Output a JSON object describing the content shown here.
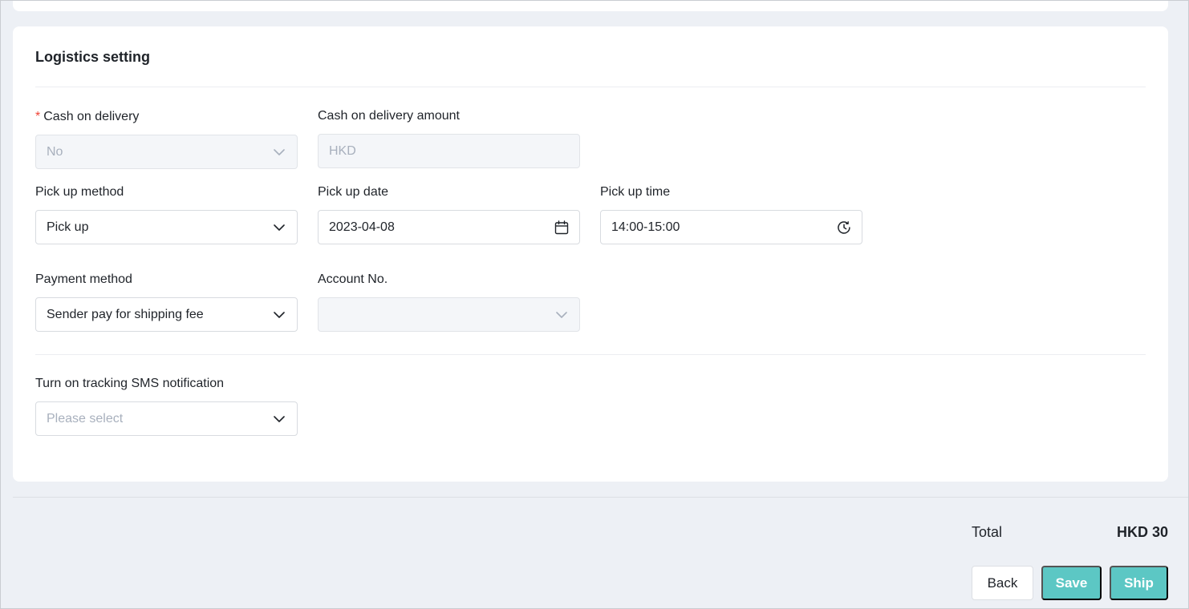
{
  "section": {
    "title": "Logistics setting"
  },
  "fields": {
    "cod": {
      "label": "Cash on delivery",
      "required_mark": "*",
      "value": "No"
    },
    "cod_amount": {
      "label": "Cash on delivery amount",
      "placeholder": "HKD"
    },
    "pickup_method": {
      "label": "Pick up method",
      "value": "Pick up"
    },
    "pickup_date": {
      "label": "Pick up date",
      "value": "2023-04-08"
    },
    "pickup_time": {
      "label": "Pick up time",
      "value": "14:00-15:00"
    },
    "payment_method": {
      "label": "Payment method",
      "value": "Sender pay for shipping fee"
    },
    "account_no": {
      "label": "Account No.",
      "value": ""
    },
    "sms": {
      "label": "Turn on tracking SMS notification",
      "placeholder": "Please select"
    }
  },
  "footer": {
    "total_label": "Total",
    "total_value": "HKD 30",
    "back_label": "Back",
    "save_label": "Save",
    "ship_label": "Ship"
  },
  "icons": {
    "select": "chevron-down-icon",
    "date": "calendar-icon",
    "time": "clock-icon"
  },
  "colors": {
    "accent": "#5cc7c4",
    "required": "#f04438",
    "background": "#edf0f5"
  }
}
